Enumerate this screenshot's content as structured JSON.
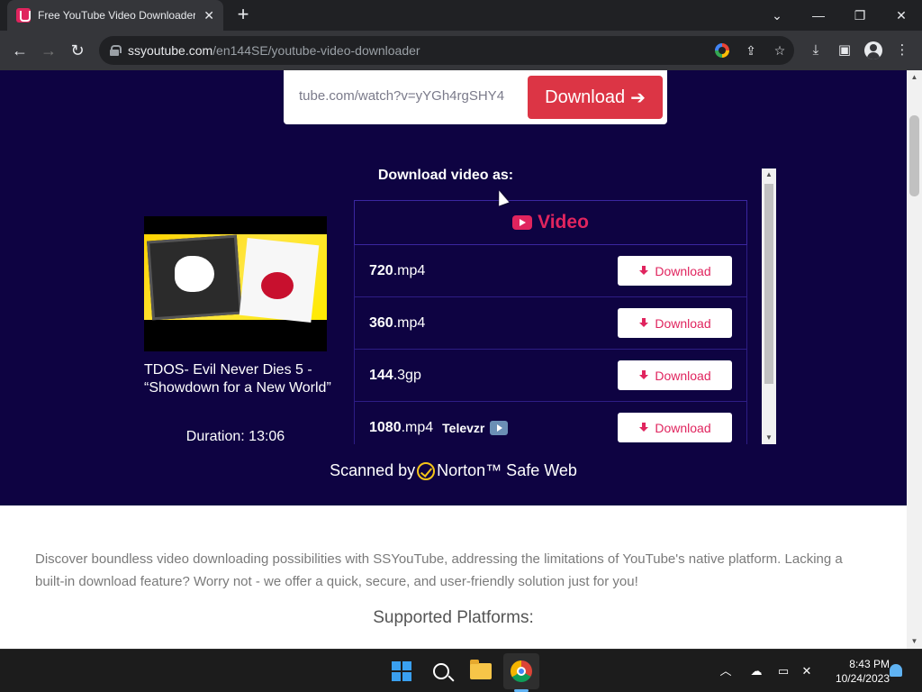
{
  "browser": {
    "tab_title": "Free YouTube Video Downloader",
    "tab_close": "✕",
    "new_tab": "+",
    "url_host": "ssyoutube.com",
    "url_path": "/en144SE/youtube-video-downloader",
    "window_controls": {
      "chevron": "⌄",
      "minimize": "—",
      "restore": "❐",
      "close": "✕"
    }
  },
  "page": {
    "url_input_value": "tube.com/watch?v=yYGh4rgSHY4",
    "download_button": "Download",
    "download_as_heading": "Download video as:",
    "video_title": "TDOS- Evil Never Dies 5 - “Showdown for a New World”",
    "duration": "Duration: 13:06",
    "formats_header": "Video",
    "formats": [
      {
        "quality": "720",
        "ext": ".mp4",
        "extra": "",
        "button": "Download"
      },
      {
        "quality": "360",
        "ext": ".mp4",
        "extra": "",
        "button": "Download"
      },
      {
        "quality": "144",
        "ext": ".3gp",
        "extra": "",
        "button": "Download"
      },
      {
        "quality": "1080",
        "ext": ".mp4",
        "extra": "Televzr",
        "button": "Download"
      }
    ],
    "norton_prefix": "Scanned by",
    "norton_suffix": "Norton™ Safe Web",
    "description": "Discover boundless video downloading possibilities with SSYouTube, addressing the limitations of YouTube's native platform. Lacking a built-in download feature? Worry not - we offer a quick, secure, and user-friendly solution just for you!",
    "supported_platforms": "Supported Platforms:"
  },
  "taskbar": {
    "time": "8:43 PM",
    "date": "10/24/2023"
  },
  "colors": {
    "hero_bg": "#0e0342",
    "accent_red": "#dc3545",
    "accent_pink": "#e0245e"
  }
}
